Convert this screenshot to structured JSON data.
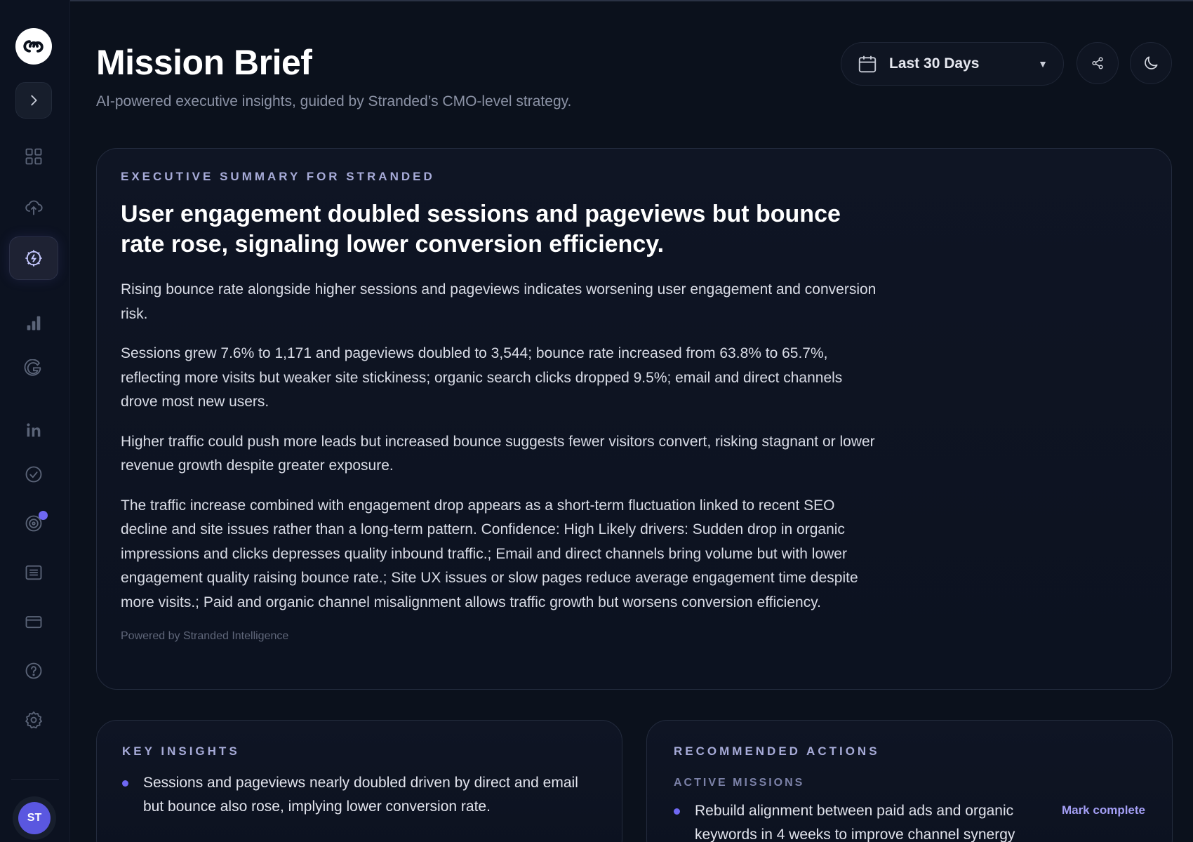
{
  "header": {
    "title": "Mission Brief",
    "subtitle": "AI-powered executive insights, guided by Stranded’s CMO-level strategy.",
    "date_range": "Last 30 Days"
  },
  "sidebar": {
    "avatar_initials": "ST",
    "items": [
      {
        "icon": "dashboard-grid-icon"
      },
      {
        "icon": "cloud-sync-icon"
      },
      {
        "icon": "mission-brief-icon",
        "active": true
      },
      {
        "icon": "bar-chart-icon"
      },
      {
        "icon": "google-icon"
      },
      {
        "icon": "linkedin-icon"
      },
      {
        "icon": "check-circle-icon"
      },
      {
        "icon": "target-icon",
        "notification": true
      },
      {
        "icon": "list-icon"
      },
      {
        "icon": "billing-card-icon"
      },
      {
        "icon": "help-icon"
      },
      {
        "icon": "settings-icon"
      }
    ]
  },
  "summary": {
    "eyebrow": "EXECUTIVE SUMMARY FOR STRANDED",
    "headline": "User engagement doubled sessions and pageviews but bounce rate rose, signaling lower conversion efficiency.",
    "paragraphs": [
      "Rising bounce rate alongside higher sessions and pageviews indicates worsening user engagement and conversion risk.",
      "Sessions grew 7.6% to 1,171 and pageviews doubled to 3,544; bounce rate increased from 63.8% to 65.7%, reflecting more visits but weaker site stickiness; organic search clicks dropped 9.5%; email and direct channels drove most new users.",
      "Higher traffic could push more leads but increased bounce suggests fewer visitors convert, risking stagnant or lower revenue growth despite greater exposure.",
      "The traffic increase combined with engagement drop appears as a short-term fluctuation linked to recent SEO decline and site issues rather than a long-term pattern. Confidence: High Likely drivers: Sudden drop in organic impressions and clicks depresses quality inbound traffic.; Email and direct channels bring volume but with lower engagement quality raising bounce rate.; Site UX issues or slow pages reduce average engagement time despite more visits.; Paid and organic channel misalignment allows traffic growth but worsens conversion efficiency."
    ],
    "powered_by": "Powered by Stranded Intelligence"
  },
  "insights": {
    "title": "KEY INSIGHTS",
    "items": [
      "Sessions and pageviews nearly doubled driven by direct and email but bounce also rose, implying lower conversion rate."
    ]
  },
  "actions": {
    "title": "RECOMMENDED ACTIONS",
    "subtitle": "ACTIVE MISSIONS",
    "items": [
      {
        "text": "Rebuild alignment between paid ads and organic keywords in 4 weeks to improve channel synergy",
        "action_label": "Mark complete"
      }
    ]
  },
  "colors": {
    "background": "#0b111c",
    "accent": "#6f68f3",
    "accent_text": "#a49ff5"
  }
}
